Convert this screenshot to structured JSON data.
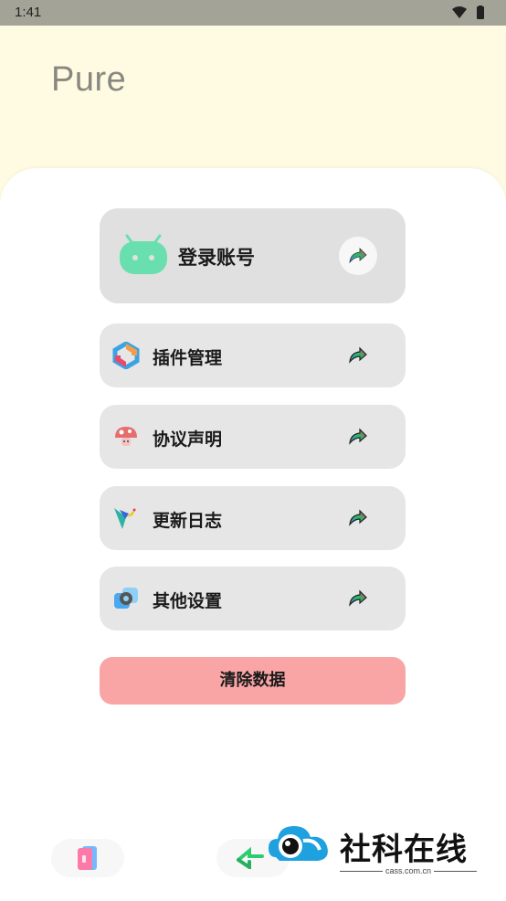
{
  "status_bar": {
    "time": "1:41"
  },
  "app": {
    "title": "Pure"
  },
  "login": {
    "label": "登录账号"
  },
  "menu": {
    "items": [
      {
        "label": "插件管理",
        "icon": "plugin-hexagon-icon"
      },
      {
        "label": "协议声明",
        "icon": "mushroom-icon"
      },
      {
        "label": "更新日志",
        "icon": "bird-icon"
      },
      {
        "label": "其他设置",
        "icon": "settings-gear-icon"
      }
    ]
  },
  "actions": {
    "clear_data": "清除数据"
  },
  "watermark": {
    "title": "社科在线",
    "subtitle": "cass.com.cn"
  },
  "colors": {
    "status_bar": "#a3a398",
    "header_bg": "#fffbe3",
    "card_bg": "#e6e6e6",
    "clear_button": "#f9a5a5",
    "android_green": "#69dfb0"
  }
}
